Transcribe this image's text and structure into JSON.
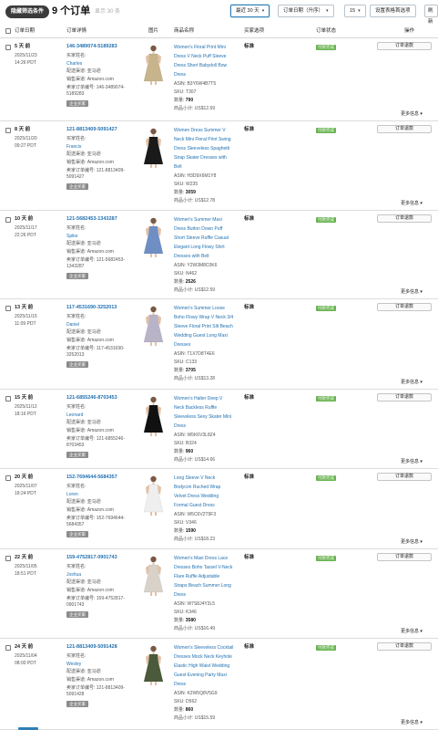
{
  "topbar": {
    "hide_filters_label": "隐藏筛选条件",
    "order_count": "9 个订单",
    "subcount": "显示 30 条",
    "range_select": "最近 30 天",
    "sort_select": "订单日期（升序）",
    "per_page_select": "15",
    "table_settings_label": "设置表格首选项",
    "refresh_label": "刷新"
  },
  "headers": {
    "date": "订单日期",
    "detail": "订单详情",
    "image": "图片",
    "product": "商品名称",
    "shipping": "买家选项",
    "status": "订单状态",
    "action": "操作"
  },
  "labels": {
    "buyer_name": "买家姓名:",
    "channel": "配送渠道: 亚马逊",
    "channel_site": "销售渠道: Amazon.com",
    "seller_order_prefix": "卖家订单编号:",
    "business_tag": "企业买家",
    "status_badge": "付款完成",
    "refund_button": "订单退款",
    "more_info": "更多信息 ▾"
  },
  "orders": [
    {
      "ago": "5 天 前",
      "date": "2025/11/23",
      "time": "14:26 PDT",
      "order_id": "146-3489074-5189283",
      "buyer": "Charles",
      "seller_order_a": "卖家订单编号: 146-3489074-",
      "seller_order_b": "5189283",
      "product_lines": [
        "Women's Floral Print Mini",
        "Dress V Neck Puff Sleeve",
        "Dress Short Babydoll Bow",
        "Dress"
      ],
      "asin": "ASIN: B3Y6W4B7T5",
      "sku": "SKU: T307",
      "qty_label": "数量: ",
      "qty": "790",
      "price": "商品小计: US$12.69",
      "shipping": "标准",
      "dress_color": "#c8b48c"
    },
    {
      "ago": "8 天 前",
      "date": "2025/11/20",
      "time": "09:27 PDT",
      "order_id": "121-8813409-5091427",
      "buyer": "Francis",
      "seller_order_a": "卖家订单编号: 121-8813409-",
      "seller_order_b": "5091427",
      "product_lines": [
        "Women Dress Summer V",
        "Neck Mini Floral Print Swing",
        "Dress Sleeveless Spaghetti",
        "Strap Skater Dresses with",
        "Belt"
      ],
      "asin": "ASIN: H3D9X6M1Y8",
      "sku": "SKU: W235",
      "qty_label": "数量: ",
      "qty": "3059",
      "price": "商品小计: US$12.78",
      "shipping": "标准",
      "dress_color": "#1a1a1a"
    },
    {
      "ago": "10 天 前",
      "date": "2025/11/17",
      "time": "22:26 PDT",
      "order_id": "121-5682453-1343287",
      "buyer": "Spike",
      "seller_order_a": "卖家订单编号: 121-5682453-",
      "seller_order_b": "1343287",
      "product_lines": [
        "Women's Summer Maxi",
        "Dress Button Down Puff",
        "Short Sleeve Ruffle Casual",
        "Elegant Long Flowy Shirt",
        "Dresses with Belt"
      ],
      "asin": "ASIN: Y2W3M8C0K6",
      "sku": "SKU: N462",
      "qty_label": "数量: ",
      "qty": "2526",
      "price": "商品小计: US$12.59",
      "shipping": "标准",
      "dress_color": "#6f8fc4"
    },
    {
      "ago": "13 天 前",
      "date": "2025/11/15",
      "time": "11:09 PDT",
      "order_id": "117-4531690-3252013",
      "buyer": "Daniel",
      "seller_order_a": "卖家订单编号: 117-4531690-",
      "seller_order_b": "3252013",
      "product_lines": [
        "Women's Summer Loose",
        "Boho Flowy Wrap V Neck 3/4",
        "Sleeve Floral Print Slit Beach",
        "Wedding Guest Long Maxi",
        "Dresses"
      ],
      "asin": "ASIN: T1X7D8T4E6",
      "sku": "SKU: C133",
      "qty_label": "数量: ",
      "qty": "3705",
      "price": "商品小计: US$13.28",
      "shipping": "标准",
      "dress_color": "#b9b3c8"
    },
    {
      "ago": "15 天 前",
      "date": "2025/11/12",
      "time": "18:16 PDT",
      "order_id": "121-6855246-8703453",
      "buyer": "Leonard",
      "seller_order_a": "卖家订单编号: 121-6855246-",
      "seller_order_b": "8703453",
      "product_lines": [
        "Women's Halter Deep V",
        "Neck Backless Ruffle",
        "Sleeveless Sexy Skater Mini",
        "Dress"
      ],
      "asin": "ASIN: W5K6V3L8Z4",
      "sku": "SKU: B324",
      "qty_label": "数量: ",
      "qty": "960",
      "price": "商品小计: US$14.66",
      "shipping": "标准",
      "dress_color": "#111111"
    },
    {
      "ago": "20 天 前",
      "date": "2025/11/07",
      "time": "18:24 PDT",
      "order_id": "152-7694644-5684357",
      "buyer": "Loren",
      "seller_order_a": "卖家订单编号: 152-7694644-",
      "seller_order_b": "5684357",
      "product_lines": [
        "Long Sleeve V Neck",
        "Bodycon Ruched Wrap",
        "Velvet Dress Wedding",
        "Formal Guest Dress"
      ],
      "asin": "ASIN: W5C6V2T9F3",
      "sku": "SKU: V346",
      "qty_label": "数量: ",
      "qty": "1590",
      "price": "商品小计: US$18.23",
      "shipping": "标准",
      "dress_color": "#efefef"
    },
    {
      "ago": "22 天 前",
      "date": "2025/11/05",
      "time": "18:51 PDT",
      "order_id": "159-4752817-0901743",
      "buyer": "Joshua",
      "seller_order_a": "卖家订单编号: 159-4752817-",
      "seller_order_b": "0901743",
      "product_lines": [
        "Women's Maxi Dress Lace",
        "Dresses Boho Tassel V-Neck",
        "Flare Ruffle Adjustable",
        "Straps Beach Summer Long",
        "Dress"
      ],
      "asin": "ASIN: W7S8J4Y3L5",
      "sku": "SKU: K346",
      "qty_label": "数量: ",
      "qty": "3580",
      "price": "商品小计: US$16.49",
      "shipping": "标准",
      "dress_color": "#d8d2c8"
    },
    {
      "ago": "24 天 前",
      "date": "2025/11/04",
      "time": "08:00 PDT",
      "order_id": "121-8813409-5091428",
      "buyer": "Wesley",
      "seller_order_a": "卖家订单编号: 121-8813409-",
      "seller_order_b": "5091428",
      "product_lines": [
        "Women's Sleeveless Cocktail",
        "Dresses Mock Neck Keyhole",
        "Elastic High Waist Wedding",
        "Guest Evening Party Maxi",
        "Dress"
      ],
      "asin": "ASIN: K2W5Q8V5G9",
      "sku": "SKU: D562",
      "qty_label": "数量: ",
      "qty": "860",
      "price": "商品小计: US$15.59",
      "shipping": "标准",
      "dress_color": "#4b5a3a"
    }
  ]
}
